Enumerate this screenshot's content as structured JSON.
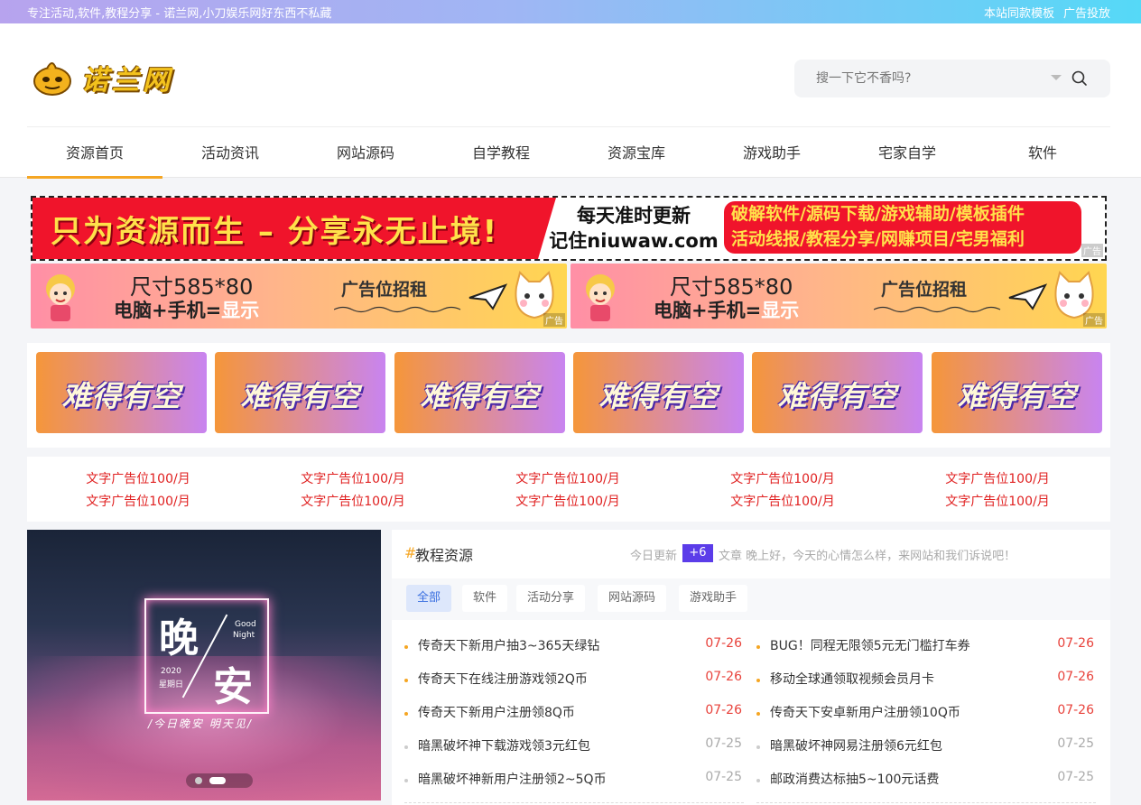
{
  "topbar": {
    "slogan": "专注活动,软件,教程分享 - 诺兰网,小刀娱乐网好东西不私藏",
    "links": [
      "本站同款模板",
      "广告投放"
    ]
  },
  "header": {
    "logo_text": "诺兰网",
    "search": {
      "placeholder": "搜一下它不香吗?",
      "icon": "search-icon"
    }
  },
  "nav": {
    "items": [
      "资源首页",
      "活动资讯",
      "网站源码",
      "自学教程",
      "资源宝库",
      "游戏助手",
      "宅家自学",
      "软件"
    ],
    "active_index": 0,
    "accent": "#f5a623"
  },
  "banner": {
    "slogan": "只为资源而生 – 分享永无止境!",
    "line1": "每天准时更新",
    "line2": "记住niuwaw.com",
    "right_line1": "破解软件/源码下载/游戏辅助/模板插件",
    "right_line2": "活动线报/教程分享/网赚项目/宅男福利",
    "ad_tag": "广告"
  },
  "ad585": {
    "size": "尺寸585*80",
    "device_prefix": "电脑+手机=",
    "device_suffix": "显示",
    "rent": "广告位招租",
    "ad_tag": "广告"
  },
  "tiles": [
    "难得有空",
    "难得有空",
    "难得有空",
    "难得有空",
    "难得有空",
    "难得有空"
  ],
  "text_ads": [
    "文字广告位100/月",
    "文字广告位100/月",
    "文字广告位100/月",
    "文字广告位100/月",
    "文字广告位100/月",
    "文字广告位100/月",
    "文字广告位100/月",
    "文字广告位100/月",
    "文字广告位100/月",
    "文字广告位100/月"
  ],
  "slider": {
    "char1": "晚",
    "char2": "安",
    "good": "Good",
    "night": "Night",
    "year": "2020",
    "weekday": "星期日",
    "caption": "/今日晚安 明天见/"
  },
  "list": {
    "hash": "#",
    "title": "教程资源",
    "updated_label": "今日更新",
    "updated_count": "+6",
    "greeting": "文章 晚上好，今天的心情怎么样，来网站和我们诉说吧！",
    "tabs": [
      "全部",
      "软件",
      "活动分享",
      "网站源码",
      "游戏助手"
    ],
    "left_posts": [
      {
        "title": "传奇天下新用户抽3~365天绿钻",
        "date": "07-26",
        "hot": true
      },
      {
        "title": "传奇天下在线注册游戏领2Q币",
        "date": "07-26",
        "hot": true
      },
      {
        "title": "传奇天下新用户注册领8Q币",
        "date": "07-26",
        "hot": true
      },
      {
        "title": "暗黑破坏神下载游戏领3元红包",
        "date": "07-25",
        "hot": false
      },
      {
        "title": "暗黑破坏神新用户注册领2~5Q币",
        "date": "07-25",
        "hot": false
      }
    ],
    "right_posts": [
      {
        "title": "BUG！同程无限领5元无门槛打车券",
        "date": "07-26",
        "hot": true
      },
      {
        "title": "移动全球通领取视频会员月卡",
        "date": "07-26",
        "hot": true
      },
      {
        "title": "传奇天下安卓新用户注册领10Q币",
        "date": "07-26",
        "hot": true
      },
      {
        "title": "暗黑破坏神网易注册领6元红包",
        "date": "07-25",
        "hot": false
      },
      {
        "title": "邮政消费达标抽5~100元话费",
        "date": "07-25",
        "hot": false
      }
    ],
    "colors": {
      "hot_date": "#e8423b",
      "old_date": "#aaaaaa",
      "hot_bullet": "#f5a623",
      "old_bullet": "#cccccc"
    }
  }
}
